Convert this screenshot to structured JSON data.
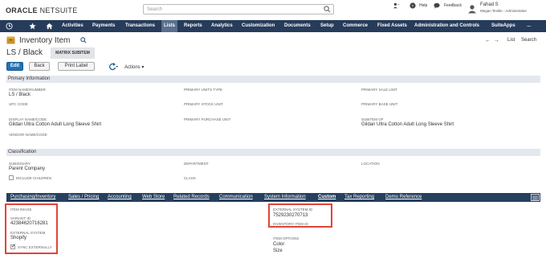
{
  "header": {
    "logo_main": "ORACLE",
    "logo_sub": "NETSUITE",
    "search_placeholder": "Search",
    "help": "Help",
    "feedback": "Feedback",
    "user_name": "Fahad S",
    "user_role": "Megan Textile - Administrator"
  },
  "nav": {
    "items": [
      "Activities",
      "Payments",
      "Transactions",
      "Lists",
      "Reports",
      "Analytics",
      "Customization",
      "Documents",
      "Setup",
      "Commerce",
      "Fixed Assets",
      "Administration and Controls",
      "SuiteApps",
      "..."
    ],
    "active": "Lists"
  },
  "page": {
    "title": "Inventory Item",
    "record_name": "LS / Black",
    "badge": "MATRIX SUBITEM",
    "list_link": "List",
    "search_link": "Search",
    "buttons": {
      "edit": "Edit",
      "back": "Back",
      "print": "Print Label",
      "actions": "Actions"
    }
  },
  "primary": {
    "title": "Primary Information",
    "item_name_label": "ITEM NAME/NUMBER",
    "item_name_value": "LS / Black",
    "upc_label": "UPC CODE",
    "display_name_label": "DISPLAY NAME/CODE",
    "display_name_value": "Gildan Ultra Cotton Adult Long Sleeve Shirt",
    "vendor_name_label": "VENDOR NAME/CODE",
    "units_type_label": "PRIMARY UNITS TYPE",
    "stock_unit_label": "PRIMARY STOCK UNIT",
    "purchase_unit_label": "PRIMARY PURCHASE UNIT",
    "sale_unit_label": "PRIMARY SALE UNIT",
    "base_unit_label": "PRIMARY BASE UNIT",
    "subitem_label": "SUBITEM OF",
    "subitem_value": "Gildan Ultra Cotton Adult Long Sleeve Shirt"
  },
  "classification": {
    "title": "Classification",
    "subsidiary_label": "SUBSIDIARY",
    "subsidiary_value": "Parent Company",
    "include_children": "INCLUDE CHILDREN",
    "department_label": "DEPARTMENT",
    "class_label": "CLASS",
    "location_label": "LOCATION"
  },
  "tabs": {
    "items": [
      "Purchasing/Inventory",
      "Sales / Pricing",
      "Accounting",
      "Web Store",
      "Related Records",
      "Communication",
      "System Information",
      "Custom",
      "Tax Reporting",
      "Demo Reference"
    ],
    "active": "Custom"
  },
  "custom": {
    "item_image_label": "ITEM IMAGE",
    "variant_id_label": "VARIANT ID",
    "variant_id_value": "42384620716281",
    "external_system_label": "EXTERNAL SYSTEM",
    "external_system_value": "Shopify",
    "sync_externally": "SYNC EXTERNALLY",
    "external_system_id_label": "EXTERNAL SYSTEM ID",
    "external_system_id_value": "7529230270713",
    "inventory_item_id_label": "INVENTORY ITEM ID",
    "item_options_label": "ITEM OPTIONS",
    "item_option_1": "Color",
    "item_option_2": "Size"
  },
  "colors": {
    "nav_bg": "#263c5b",
    "primary_button": "#1f73b7",
    "highlight": "#e0443a"
  }
}
